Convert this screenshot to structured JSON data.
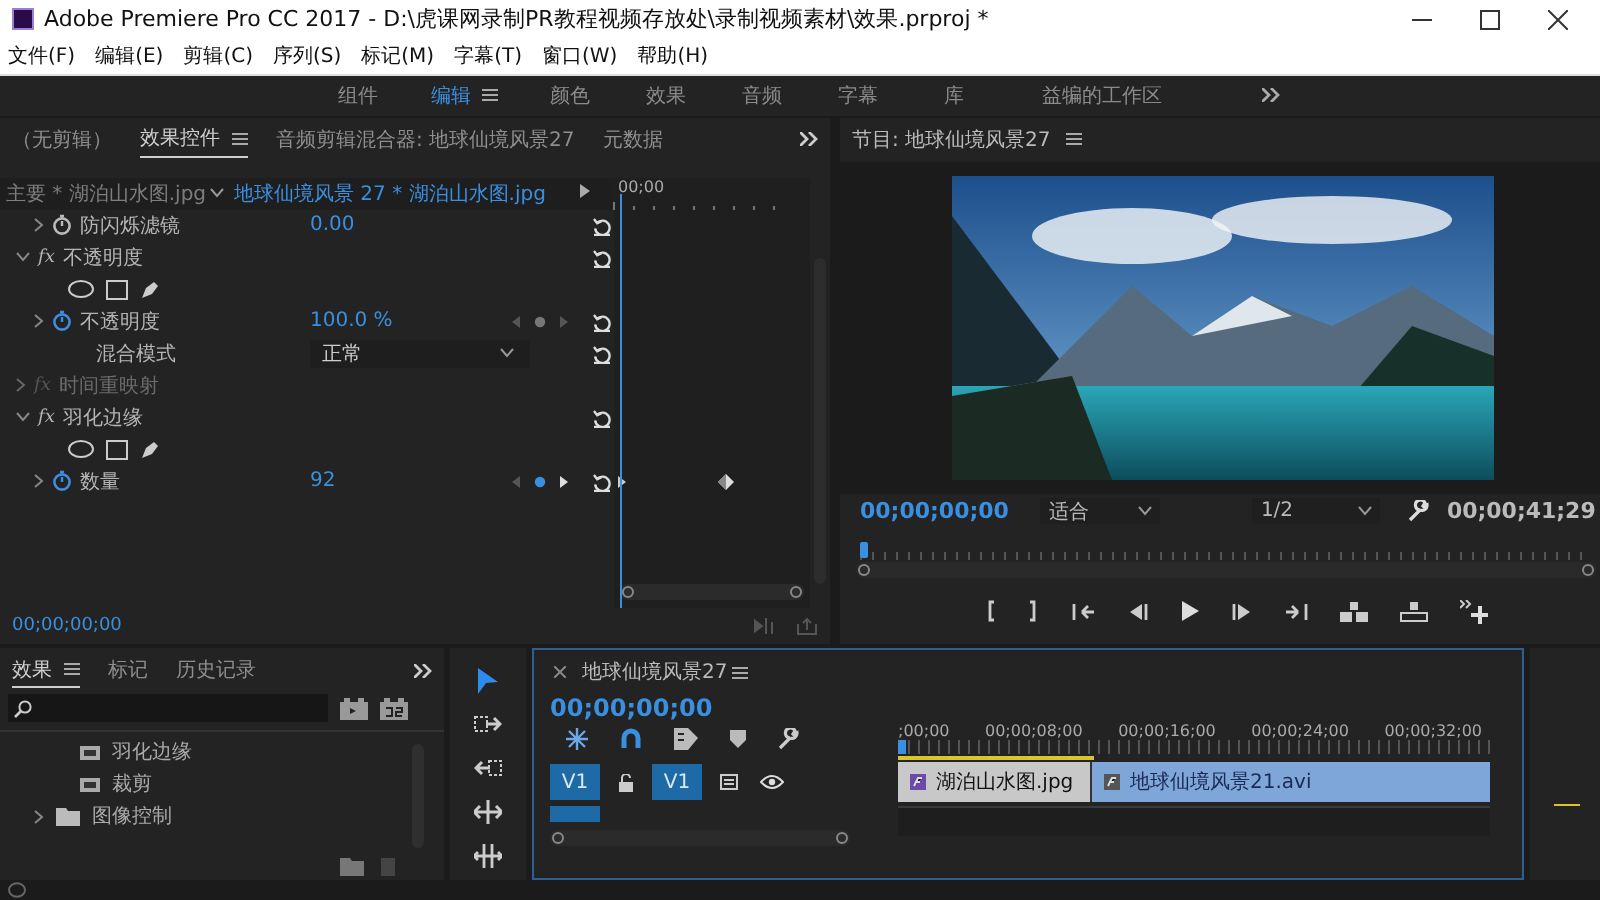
{
  "window": {
    "title": "Adobe Premiere Pro CC 2017 - D:\\虎课网录制PR教程视频存放处\\录制视频素材\\效果.prproj *"
  },
  "menu": [
    "文件(F)",
    "编辑(E)",
    "剪辑(C)",
    "序列(S)",
    "标记(M)",
    "字幕(T)",
    "窗口(W)",
    "帮助(H)"
  ],
  "workspaces": [
    {
      "label": "组件",
      "selected": false
    },
    {
      "label": "编辑",
      "selected": true
    },
    {
      "label": "颜色",
      "selected": false
    },
    {
      "label": "效果",
      "selected": false
    },
    {
      "label": "音频",
      "selected": false
    },
    {
      "label": "字幕",
      "selected": false
    },
    {
      "label": "库",
      "selected": false
    },
    {
      "label": "益犏的工作区",
      "selected": false
    }
  ],
  "effect_controls": {
    "tabs": [
      {
        "label": "（无剪辑）",
        "selected": false
      },
      {
        "label": "效果控件",
        "selected": true
      },
      {
        "label": "音频剪辑混合器: 地球仙境风景27",
        "selected": false
      },
      {
        "label": "元数据",
        "selected": false
      }
    ],
    "master": "主要 * 湖泊山水图.jpg",
    "clip": "地球仙境风景 27 * 湖泊山水图.jpg",
    "ruler_start": "00;00",
    "rows": [
      {
        "kind": "param",
        "label": "防闪烁滤镜",
        "value": "0.00",
        "animated": false,
        "keyframe": false
      },
      {
        "kind": "effect",
        "badge": "fx",
        "label": "不透明度",
        "expanded": true,
        "disabled": false
      },
      {
        "kind": "masks"
      },
      {
        "kind": "param",
        "label": "不透明度",
        "value": "100.0 %",
        "animated": true,
        "keyframe": false
      },
      {
        "kind": "dropdown",
        "label": "混合模式",
        "value": "正常"
      },
      {
        "kind": "effect",
        "badge": "fx",
        "label": "时间重映射",
        "expanded": false,
        "disabled": true
      },
      {
        "kind": "effect",
        "badge": "fx",
        "label": "羽化边缘",
        "expanded": true,
        "disabled": false
      },
      {
        "kind": "masks"
      },
      {
        "kind": "param",
        "label": "数量",
        "value": "92",
        "animated": true,
        "keyframe": true
      }
    ],
    "timecode": "00;00;00;00"
  },
  "program": {
    "title": "节目: 地球仙境风景27",
    "timecode": "00;00;00;00",
    "zoom": "适合",
    "resolution": "1/2",
    "duration": "00;00;41;29",
    "level": 0
  },
  "effects_panel": {
    "tabs": [
      {
        "label": "效果",
        "selected": true
      },
      {
        "label": "标记",
        "selected": false
      },
      {
        "label": "历史记录",
        "selected": false
      }
    ],
    "tree": [
      {
        "kind": "effect",
        "label": "羽化边缘"
      },
      {
        "kind": "effect",
        "label": "裁剪"
      },
      {
        "kind": "folder",
        "label": "图像控制",
        "expanded": false
      }
    ]
  },
  "tools": [
    {
      "kind": "select",
      "selected": true
    },
    {
      "kind": "track_select",
      "selected": false
    },
    {
      "kind": "ripple",
      "selected": false
    },
    {
      "kind": "rolling",
      "selected": false
    },
    {
      "kind": "slip",
      "selected": false
    }
  ],
  "timeline": {
    "title": "地球仙境风景27",
    "timecode": "00;00;00;00",
    "ruler": [
      ";00;00",
      "00;00;08;00",
      "00;00;16;00",
      "00;00;24;00",
      "00;00;32;00"
    ],
    "track": {
      "source": "V1",
      "target": "V1"
    },
    "clips": [
      {
        "kind": "still",
        "name": "湖泊山水图.jpg"
      },
      {
        "kind": "video",
        "name": "地球仙境风景21.avi"
      }
    ]
  }
}
